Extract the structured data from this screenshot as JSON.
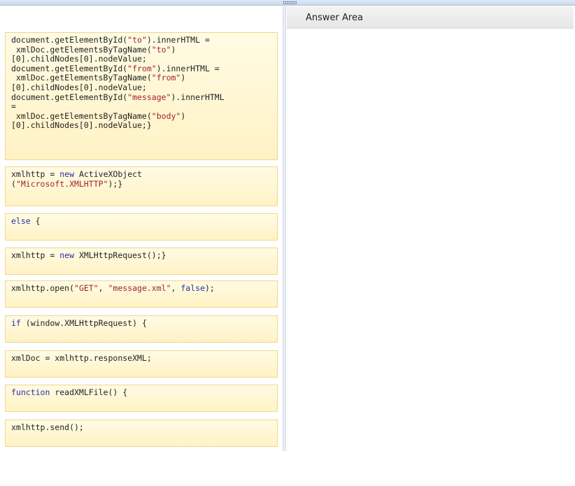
{
  "header": {
    "answer_area_title": "Answer Area"
  },
  "colors": {
    "keyword": "#2a2fa6",
    "string": "#a0252e",
    "block_fill_top": "#fffbe4",
    "block_fill_bottom": "#fff2c4",
    "block_border": "#eed88a"
  },
  "source_blocks": [
    {
      "lines": [
        [
          {
            "t": "document.getElementById(",
            "c": ""
          },
          {
            "t": "\"to\"",
            "c": "str"
          },
          {
            "t": ").innerHTML =",
            "c": ""
          }
        ],
        [
          {
            "t": " xmlDoc.getElementsByTagName(",
            "c": ""
          },
          {
            "t": "\"to\"",
            "c": "str"
          },
          {
            "t": ")",
            "c": ""
          }
        ],
        [
          {
            "t": "[0].childNodes[0].nodeValue;",
            "c": ""
          }
        ],
        [
          {
            "t": "document.getElementById(",
            "c": ""
          },
          {
            "t": "\"from\"",
            "c": "str"
          },
          {
            "t": ").innerHTML =",
            "c": ""
          }
        ],
        [
          {
            "t": " xmlDoc.getElementsByTagName(",
            "c": ""
          },
          {
            "t": "\"from\"",
            "c": "str"
          },
          {
            "t": ")",
            "c": ""
          }
        ],
        [
          {
            "t": "[0].childNodes[0].nodeValue;",
            "c": ""
          }
        ],
        [
          {
            "t": "document.getElementById(",
            "c": ""
          },
          {
            "t": "\"message\"",
            "c": "str"
          },
          {
            "t": ").innerHTML",
            "c": ""
          }
        ],
        [
          {
            "t": "=",
            "c": ""
          }
        ],
        [
          {
            "t": " xmlDoc.getElementsByTagName(",
            "c": ""
          },
          {
            "t": "\"body\"",
            "c": "str"
          },
          {
            "t": ")",
            "c": ""
          }
        ],
        [
          {
            "t": "[0].childNodes[0].nodeValue;}",
            "c": ""
          }
        ]
      ]
    },
    {
      "lines": [
        [
          {
            "t": "xmlhttp = ",
            "c": ""
          },
          {
            "t": "new",
            "c": "kw"
          },
          {
            "t": " ActiveXObject",
            "c": ""
          }
        ],
        [
          {
            "t": "(",
            "c": ""
          },
          {
            "t": "\"Microsoft.XMLHTTP\"",
            "c": "str"
          },
          {
            "t": ");}",
            "c": ""
          }
        ]
      ]
    },
    {
      "lines": [
        [
          {
            "t": "else",
            "c": "kw"
          },
          {
            "t": " {",
            "c": ""
          }
        ]
      ]
    },
    {
      "lines": [
        [
          {
            "t": "xmlhttp = ",
            "c": ""
          },
          {
            "t": "new",
            "c": "kw"
          },
          {
            "t": " XMLHttpRequest();}",
            "c": ""
          }
        ]
      ]
    },
    {
      "lines": [
        [
          {
            "t": "xmlhttp.open(",
            "c": ""
          },
          {
            "t": "\"GET\"",
            "c": "str"
          },
          {
            "t": ", ",
            "c": ""
          },
          {
            "t": "\"message.xml\"",
            "c": "str"
          },
          {
            "t": ", ",
            "c": ""
          },
          {
            "t": "false",
            "c": "kw"
          },
          {
            "t": ");",
            "c": ""
          }
        ]
      ]
    },
    {
      "lines": [
        [
          {
            "t": "if",
            "c": "kw"
          },
          {
            "t": " (window.XMLHttpRequest) {",
            "c": ""
          }
        ]
      ]
    },
    {
      "lines": [
        [
          {
            "t": "xmlDoc = xmlhttp.responseXML;",
            "c": ""
          }
        ]
      ]
    },
    {
      "lines": [
        [
          {
            "t": "function",
            "c": "kw"
          },
          {
            "t": " readXMLFile() {",
            "c": ""
          }
        ]
      ]
    },
    {
      "lines": [
        [
          {
            "t": "xmlhttp.send();",
            "c": ""
          }
        ]
      ]
    }
  ]
}
